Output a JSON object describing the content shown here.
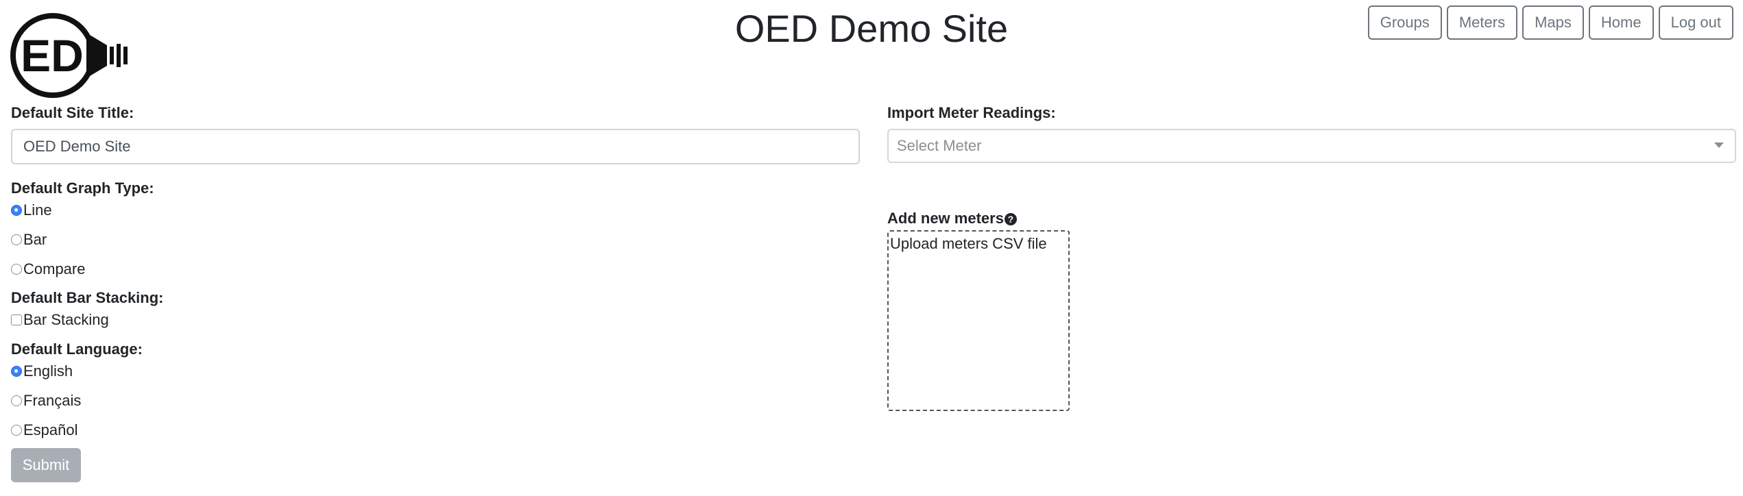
{
  "header": {
    "title": "OED Demo Site",
    "logo_text": "ED",
    "nav": [
      "Groups",
      "Meters",
      "Maps",
      "Home",
      "Log out"
    ]
  },
  "form": {
    "site_title_label": "Default Site Title:",
    "site_title_value": "OED Demo Site",
    "graph_type_label": "Default Graph Type:",
    "graph_types": [
      {
        "label": "Line",
        "checked": true
      },
      {
        "label": "Bar",
        "checked": false
      },
      {
        "label": "Compare",
        "checked": false
      }
    ],
    "bar_stacking_label": "Default Bar Stacking:",
    "bar_stacking_option": "Bar Stacking",
    "bar_stacking_checked": false,
    "language_label": "Default Language:",
    "languages": [
      {
        "label": "English",
        "checked": true
      },
      {
        "label": "Français",
        "checked": false
      },
      {
        "label": "Español",
        "checked": false
      }
    ],
    "submit_label": "Submit"
  },
  "import": {
    "label": "Import Meter Readings:",
    "select_placeholder": "Select Meter",
    "add_meters_label": "Add new meters",
    "help_icon_glyph": "?",
    "dropzone_text": "Upload meters CSV file"
  },
  "colors": {
    "accent": "#3b82f6",
    "button_border": "#6c757d",
    "submit_disabled": "#a8aeb4"
  }
}
